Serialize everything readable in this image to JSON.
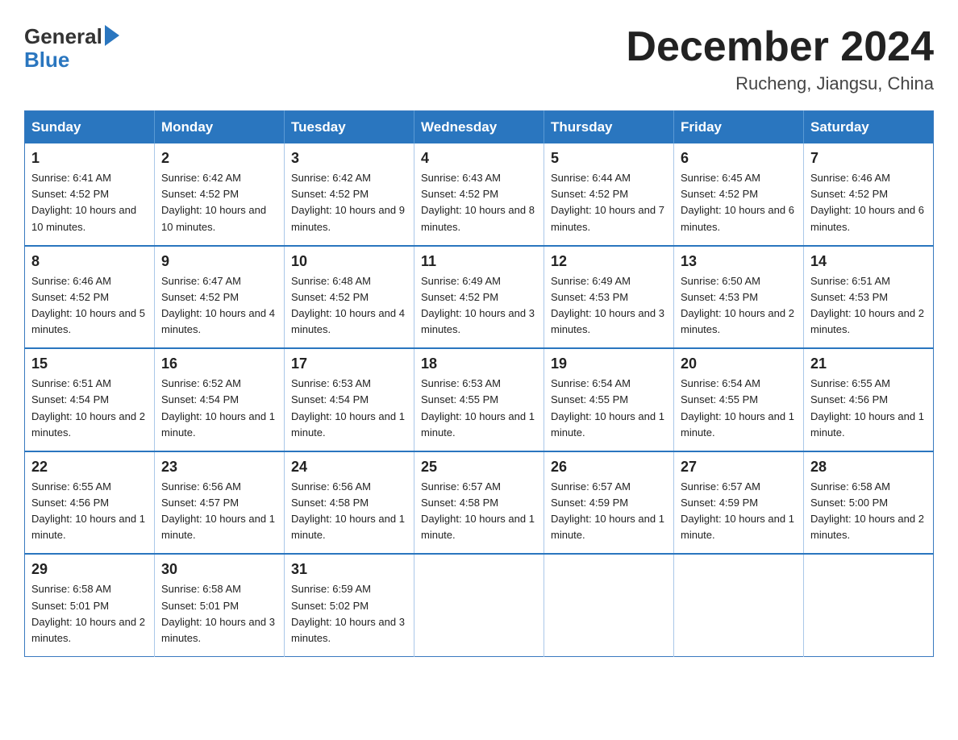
{
  "header": {
    "logo_general": "General",
    "logo_blue": "Blue",
    "month_title": "December 2024",
    "location": "Rucheng, Jiangsu, China"
  },
  "days_of_week": [
    "Sunday",
    "Monday",
    "Tuesday",
    "Wednesday",
    "Thursday",
    "Friday",
    "Saturday"
  ],
  "weeks": [
    [
      {
        "day": "1",
        "sunrise": "Sunrise: 6:41 AM",
        "sunset": "Sunset: 4:52 PM",
        "daylight": "Daylight: 10 hours and 10 minutes."
      },
      {
        "day": "2",
        "sunrise": "Sunrise: 6:42 AM",
        "sunset": "Sunset: 4:52 PM",
        "daylight": "Daylight: 10 hours and 10 minutes."
      },
      {
        "day": "3",
        "sunrise": "Sunrise: 6:42 AM",
        "sunset": "Sunset: 4:52 PM",
        "daylight": "Daylight: 10 hours and 9 minutes."
      },
      {
        "day": "4",
        "sunrise": "Sunrise: 6:43 AM",
        "sunset": "Sunset: 4:52 PM",
        "daylight": "Daylight: 10 hours and 8 minutes."
      },
      {
        "day": "5",
        "sunrise": "Sunrise: 6:44 AM",
        "sunset": "Sunset: 4:52 PM",
        "daylight": "Daylight: 10 hours and 7 minutes."
      },
      {
        "day": "6",
        "sunrise": "Sunrise: 6:45 AM",
        "sunset": "Sunset: 4:52 PM",
        "daylight": "Daylight: 10 hours and 6 minutes."
      },
      {
        "day": "7",
        "sunrise": "Sunrise: 6:46 AM",
        "sunset": "Sunset: 4:52 PM",
        "daylight": "Daylight: 10 hours and 6 minutes."
      }
    ],
    [
      {
        "day": "8",
        "sunrise": "Sunrise: 6:46 AM",
        "sunset": "Sunset: 4:52 PM",
        "daylight": "Daylight: 10 hours and 5 minutes."
      },
      {
        "day": "9",
        "sunrise": "Sunrise: 6:47 AM",
        "sunset": "Sunset: 4:52 PM",
        "daylight": "Daylight: 10 hours and 4 minutes."
      },
      {
        "day": "10",
        "sunrise": "Sunrise: 6:48 AM",
        "sunset": "Sunset: 4:52 PM",
        "daylight": "Daylight: 10 hours and 4 minutes."
      },
      {
        "day": "11",
        "sunrise": "Sunrise: 6:49 AM",
        "sunset": "Sunset: 4:52 PM",
        "daylight": "Daylight: 10 hours and 3 minutes."
      },
      {
        "day": "12",
        "sunrise": "Sunrise: 6:49 AM",
        "sunset": "Sunset: 4:53 PM",
        "daylight": "Daylight: 10 hours and 3 minutes."
      },
      {
        "day": "13",
        "sunrise": "Sunrise: 6:50 AM",
        "sunset": "Sunset: 4:53 PM",
        "daylight": "Daylight: 10 hours and 2 minutes."
      },
      {
        "day": "14",
        "sunrise": "Sunrise: 6:51 AM",
        "sunset": "Sunset: 4:53 PM",
        "daylight": "Daylight: 10 hours and 2 minutes."
      }
    ],
    [
      {
        "day": "15",
        "sunrise": "Sunrise: 6:51 AM",
        "sunset": "Sunset: 4:54 PM",
        "daylight": "Daylight: 10 hours and 2 minutes."
      },
      {
        "day": "16",
        "sunrise": "Sunrise: 6:52 AM",
        "sunset": "Sunset: 4:54 PM",
        "daylight": "Daylight: 10 hours and 1 minute."
      },
      {
        "day": "17",
        "sunrise": "Sunrise: 6:53 AM",
        "sunset": "Sunset: 4:54 PM",
        "daylight": "Daylight: 10 hours and 1 minute."
      },
      {
        "day": "18",
        "sunrise": "Sunrise: 6:53 AM",
        "sunset": "Sunset: 4:55 PM",
        "daylight": "Daylight: 10 hours and 1 minute."
      },
      {
        "day": "19",
        "sunrise": "Sunrise: 6:54 AM",
        "sunset": "Sunset: 4:55 PM",
        "daylight": "Daylight: 10 hours and 1 minute."
      },
      {
        "day": "20",
        "sunrise": "Sunrise: 6:54 AM",
        "sunset": "Sunset: 4:55 PM",
        "daylight": "Daylight: 10 hours and 1 minute."
      },
      {
        "day": "21",
        "sunrise": "Sunrise: 6:55 AM",
        "sunset": "Sunset: 4:56 PM",
        "daylight": "Daylight: 10 hours and 1 minute."
      }
    ],
    [
      {
        "day": "22",
        "sunrise": "Sunrise: 6:55 AM",
        "sunset": "Sunset: 4:56 PM",
        "daylight": "Daylight: 10 hours and 1 minute."
      },
      {
        "day": "23",
        "sunrise": "Sunrise: 6:56 AM",
        "sunset": "Sunset: 4:57 PM",
        "daylight": "Daylight: 10 hours and 1 minute."
      },
      {
        "day": "24",
        "sunrise": "Sunrise: 6:56 AM",
        "sunset": "Sunset: 4:58 PM",
        "daylight": "Daylight: 10 hours and 1 minute."
      },
      {
        "day": "25",
        "sunrise": "Sunrise: 6:57 AM",
        "sunset": "Sunset: 4:58 PM",
        "daylight": "Daylight: 10 hours and 1 minute."
      },
      {
        "day": "26",
        "sunrise": "Sunrise: 6:57 AM",
        "sunset": "Sunset: 4:59 PM",
        "daylight": "Daylight: 10 hours and 1 minute."
      },
      {
        "day": "27",
        "sunrise": "Sunrise: 6:57 AM",
        "sunset": "Sunset: 4:59 PM",
        "daylight": "Daylight: 10 hours and 1 minute."
      },
      {
        "day": "28",
        "sunrise": "Sunrise: 6:58 AM",
        "sunset": "Sunset: 5:00 PM",
        "daylight": "Daylight: 10 hours and 2 minutes."
      }
    ],
    [
      {
        "day": "29",
        "sunrise": "Sunrise: 6:58 AM",
        "sunset": "Sunset: 5:01 PM",
        "daylight": "Daylight: 10 hours and 2 minutes."
      },
      {
        "day": "30",
        "sunrise": "Sunrise: 6:58 AM",
        "sunset": "Sunset: 5:01 PM",
        "daylight": "Daylight: 10 hours and 3 minutes."
      },
      {
        "day": "31",
        "sunrise": "Sunrise: 6:59 AM",
        "sunset": "Sunset: 5:02 PM",
        "daylight": "Daylight: 10 hours and 3 minutes."
      },
      null,
      null,
      null,
      null
    ]
  ]
}
